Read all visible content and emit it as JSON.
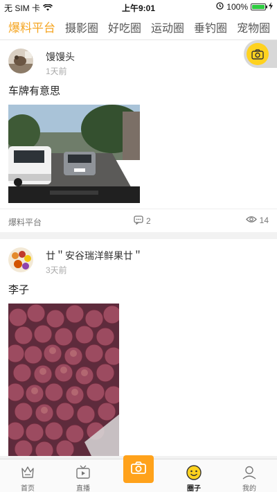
{
  "status_bar": {
    "carrier": "无 SIM 卡",
    "time": "上午9:01",
    "battery": "100%"
  },
  "tabs": [
    {
      "label": "爆料平台",
      "active": true
    },
    {
      "label": "摄影圈",
      "active": false
    },
    {
      "label": "好吃圈",
      "active": false
    },
    {
      "label": "运动圈",
      "active": false
    },
    {
      "label": "垂钓圈",
      "active": false
    },
    {
      "label": "宠物圈",
      "active": false
    }
  ],
  "posts": [
    {
      "author": "馒馒头",
      "time": "1天前",
      "text": "车牌有意思",
      "source": "爆料平台",
      "comments": "2",
      "views": "14"
    },
    {
      "author": "廿＂安谷瑞洋鲜果廿＂",
      "time": "3天前",
      "text": "李子"
    }
  ],
  "bottom_nav": {
    "home": "首页",
    "live": "直播",
    "circle": "圈子",
    "mine": "我的"
  },
  "colors": {
    "accent": "#f5a623",
    "camera_button": "#ffa21b",
    "float_camera": "#ffd21f"
  },
  "icons": [
    "wifi-icon",
    "alarm-icon",
    "battery-icon",
    "camera-icon",
    "comment-icon",
    "eye-icon",
    "crown-home-icon",
    "tv-play-icon",
    "smiley-icon",
    "person-icon"
  ]
}
